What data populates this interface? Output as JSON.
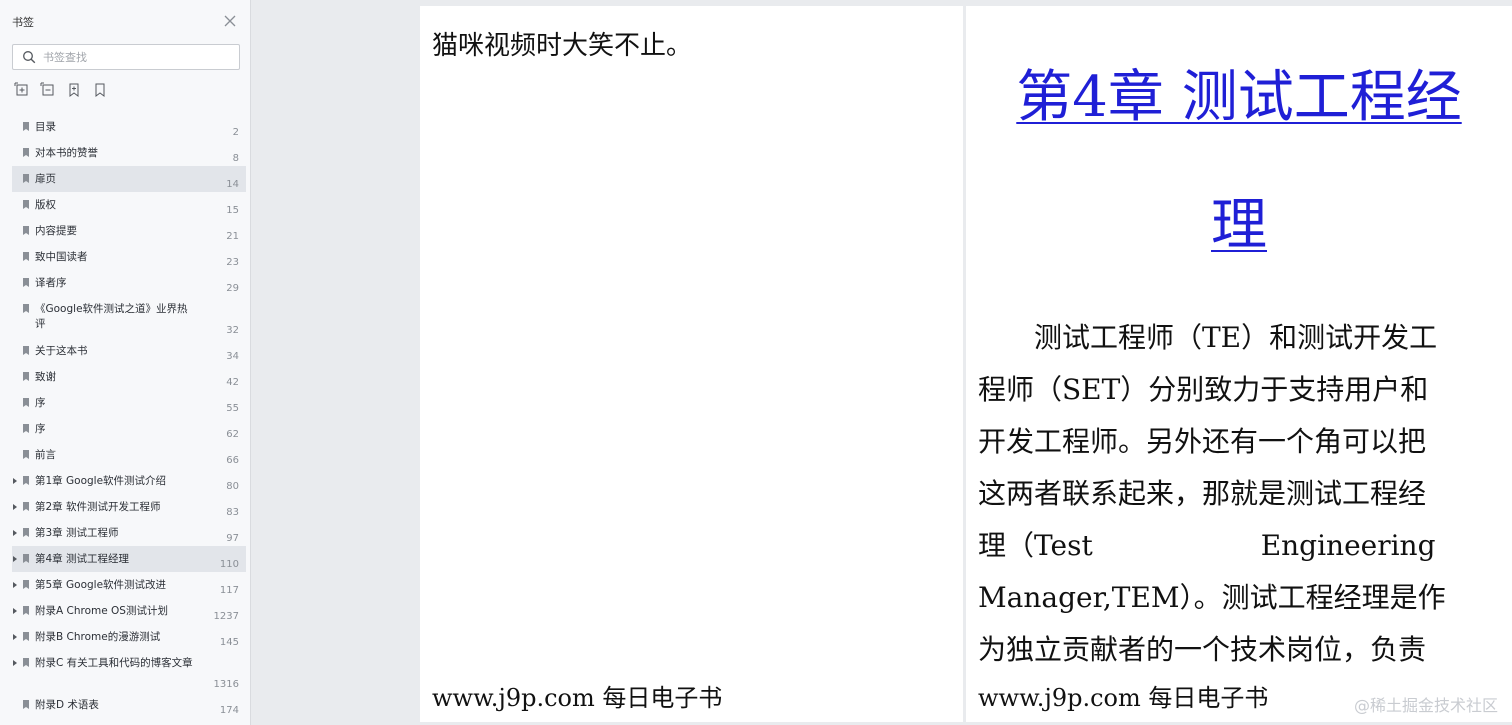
{
  "sidebar": {
    "title": "书签",
    "search_placeholder": "书签查找",
    "toolbar": [
      "expand-all-icon",
      "collapse-all-icon",
      "add-bookmark-icon",
      "bookmark-icon"
    ],
    "items": [
      {
        "label": "目录",
        "page": "2",
        "has_children": false,
        "selected": false
      },
      {
        "label": "对本书的赞誉",
        "page": "8",
        "has_children": false,
        "selected": false
      },
      {
        "label": "扉页",
        "page": "14",
        "has_children": false,
        "selected": true
      },
      {
        "label": "版权",
        "page": "15",
        "has_children": false,
        "selected": false
      },
      {
        "label": "内容提要",
        "page": "21",
        "has_children": false,
        "selected": false
      },
      {
        "label": "致中国读者",
        "page": "23",
        "has_children": false,
        "selected": false
      },
      {
        "label": "译者序",
        "page": "29",
        "has_children": false,
        "selected": false
      },
      {
        "label": "《Google软件测试之道》业界热评",
        "page": "32",
        "has_children": false,
        "selected": false
      },
      {
        "label": "关于这本书",
        "page": "34",
        "has_children": false,
        "selected": false
      },
      {
        "label": "致谢",
        "page": "42",
        "has_children": false,
        "selected": false
      },
      {
        "label": "序",
        "page": "55",
        "has_children": false,
        "selected": false
      },
      {
        "label": "序",
        "page": "62",
        "has_children": false,
        "selected": false
      },
      {
        "label": "前言",
        "page": "66",
        "has_children": false,
        "selected": false
      },
      {
        "label": "第1章 Google软件测试介绍",
        "page": "80",
        "has_children": true,
        "selected": false
      },
      {
        "label": "第2章 软件测试开发工程师",
        "page": "83",
        "has_children": true,
        "selected": false
      },
      {
        "label": "第3章 测试工程师",
        "page": "97",
        "has_children": true,
        "selected": false
      },
      {
        "label": "第4章 测试工程经理",
        "page": "110",
        "has_children": true,
        "selected": true
      },
      {
        "label": "第5章 Google软件测试改进",
        "page": "117",
        "has_children": true,
        "selected": false
      },
      {
        "label": "附录A Chrome OS测试计划",
        "page": "1237",
        "has_children": true,
        "selected": false
      },
      {
        "label": "附录B Chrome的漫游测试",
        "page": "145",
        "has_children": true,
        "selected": false
      },
      {
        "label": "附录C 有关工具和代码的博客文章",
        "page": "1316",
        "has_children": true,
        "selected": false
      },
      {
        "label": "附录D 术语表",
        "page": "174",
        "has_children": false,
        "selected": false
      }
    ]
  },
  "reader": {
    "left_page": {
      "text": "猫咪视频时大笑不止。",
      "footer": "www.j9p.com 每日电子书"
    },
    "right_page": {
      "chapter_title_line1": "第4章 测试工程经",
      "chapter_title_line2": "理",
      "body_lines": [
        "　　测试工程师（TE）和测试开发工",
        "程师（SET）分别致力于支持用户和",
        "开发工程师。另外还有一个角可以把",
        "这两者联系起来，那就是测试工程经",
        "理（Test　　　　　　Engineering",
        "Manager,TEM）。测试工程经理是作",
        "为独立贡献者的一个技术岗位，负责"
      ],
      "footer": "www.j9p.com 每日电子书",
      "watermark": "@稀土掘金技术社区"
    }
  },
  "colors": {
    "link": "#1f1fd6",
    "sidebar_bg": "#f7f8fa",
    "selected_bg": "#e2e5ea",
    "reader_bg": "#e9ebee"
  }
}
